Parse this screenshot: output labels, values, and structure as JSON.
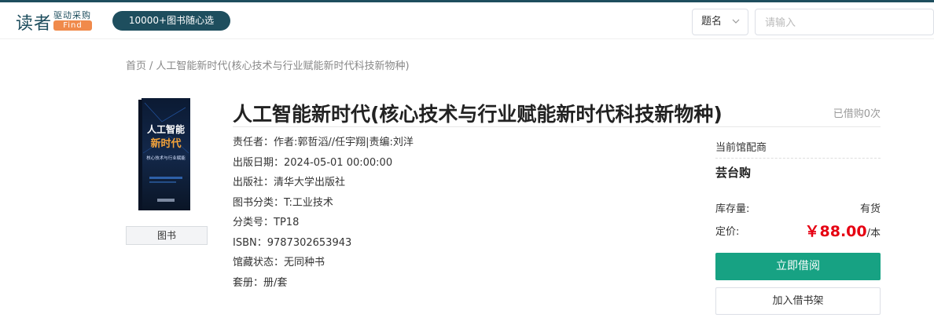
{
  "header": {
    "logo_main": "读者",
    "logo_sub": "驱动采购",
    "logo_find": "Find",
    "promo_pill": "10000+图书随心选",
    "search_type": "题名",
    "search_placeholder": "请输入"
  },
  "breadcrumb": {
    "home": "首页",
    "separator": "/",
    "current": "人工智能新时代(核心技术与行业赋能新时代科技新物种)"
  },
  "book": {
    "cover_title_line1": "人工智能",
    "cover_title_line2": "新时代",
    "cover_subtitle": "核心技术与行业赋能",
    "type_label": "图书",
    "title": "人工智能新时代(核心技术与行业赋能新时代科技新物种)",
    "borrowed": "已借购0次",
    "details": [
      {
        "label": "责任者：",
        "value": "作者:郭哲滔//任宇翔|责编:刘洋"
      },
      {
        "label": "出版日期：",
        "value": "2024-05-01 00:00:00"
      },
      {
        "label": "出版社：",
        "value": "清华大学出版社"
      },
      {
        "label": "图书分类：",
        "value": "T:工业技术"
      },
      {
        "label": "分类号：",
        "value": "TP18"
      },
      {
        "label": "ISBN：",
        "value": "9787302653943"
      },
      {
        "label": "馆藏状态：",
        "value": "无同种书"
      },
      {
        "label": "套册：",
        "value": "册/套"
      }
    ]
  },
  "side": {
    "vendor_label": "当前馆配商",
    "vendor_name": "芸台购",
    "stock_label": "库存量:",
    "stock_value": "有货",
    "price_label": "定价:",
    "price_value": "￥88.00",
    "price_unit": "/本",
    "borrow_button": "立即借阅",
    "shelf_button": "加入借书架"
  },
  "colors": {
    "brand": "#1e4e5e",
    "accent_orange": "#f08a4b",
    "primary_green": "#17a283",
    "price_red": "#e60012"
  },
  "icons": {
    "select_chevron": "chevron-down-icon"
  }
}
